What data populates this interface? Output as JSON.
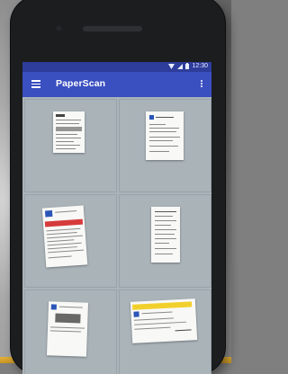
{
  "status_bar": {
    "time": "12:30"
  },
  "app_bar": {
    "title": "PaperScan"
  },
  "icons": {
    "menu": "hamburger-menu-icon",
    "overflow": "more-vert-icon",
    "wifi": "wifi-icon",
    "signal": "signal-icon",
    "battery": "battery-icon"
  },
  "colors": {
    "status_bar": "#2e3d9b",
    "app_bar": "#3a4fc0",
    "grid_background": "#aab4b9"
  },
  "documents": [
    "scanned-document-1",
    "scanned-document-2",
    "scanned-document-3",
    "scanned-document-4",
    "scanned-document-5",
    "scanned-document-6"
  ]
}
